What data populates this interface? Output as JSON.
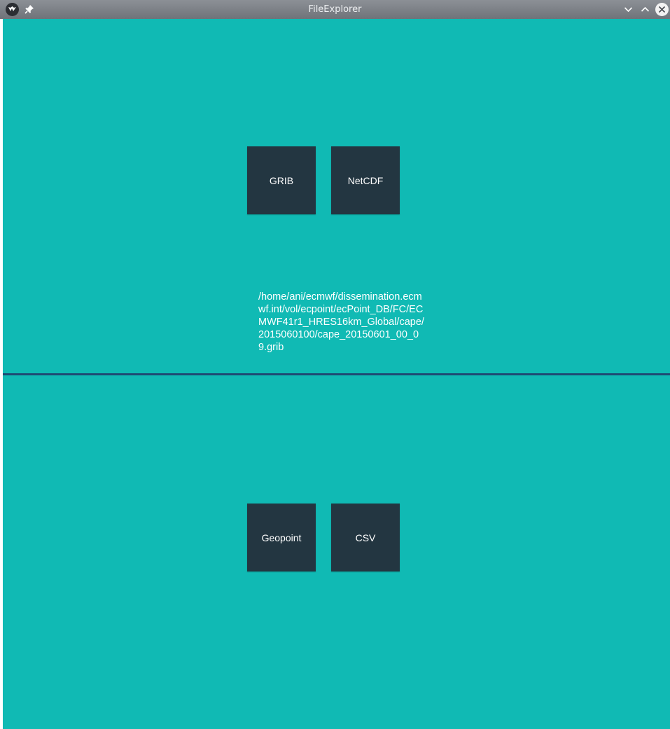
{
  "window": {
    "title": "FileExplorer",
    "icons": {
      "app": "kivy-logo-icon",
      "pin": "pin-icon",
      "minimize": "chevron-down-icon",
      "maximize": "chevron-up-icon",
      "close": "close-icon"
    }
  },
  "top_pane": {
    "buttons": {
      "grib": "GRIB",
      "netcdf": "NetCDF"
    },
    "selected_path": "/home/ani/ecmwf/dissemination.ecmwf.int/vol/ecpoint/ecPoint_DB/FC/ECMWF41r1_HRES16km_Global/cape/2015060100/cape_20150601_00_09.grib"
  },
  "bottom_pane": {
    "buttons": {
      "geopoint": "Geopoint",
      "csv": "CSV"
    }
  },
  "colors": {
    "background": "#10bab4",
    "tile": "#233641",
    "splitter": "#1f4a73"
  }
}
